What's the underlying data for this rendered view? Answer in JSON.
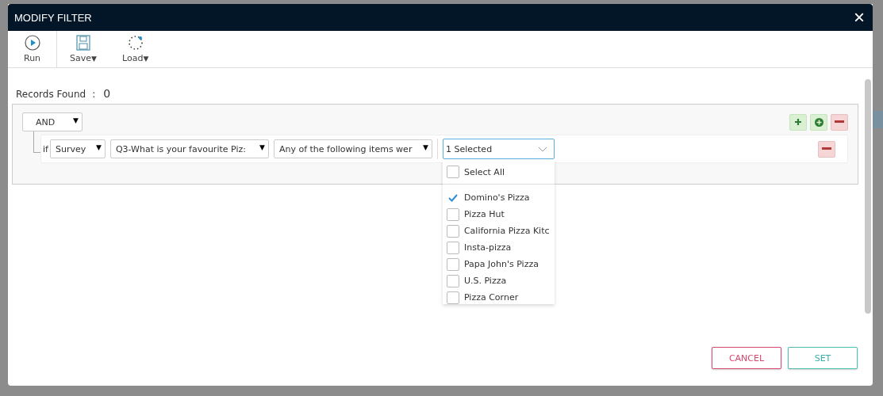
{
  "dialog": {
    "title": "MODIFY FILTER",
    "close": "×"
  },
  "toolbar": [
    {
      "label": "Run",
      "kind": "run"
    },
    {
      "label": "Save",
      "kind": "save",
      "caret": "▼"
    },
    {
      "label": "Load",
      "kind": "load",
      "caret": "▼"
    }
  ],
  "records": {
    "label": "Records Found",
    "separator": ":",
    "value": "0"
  },
  "group": {
    "operator": {
      "value": "AND",
      "caret": "▼"
    },
    "condition": {
      "prefix": "if",
      "source": {
        "value": "Survey",
        "caret": "▼"
      },
      "question": {
        "value": "Q3-What is your favourite Piz:",
        "caret": "▼"
      },
      "operator": {
        "value": "Any of the following items wer",
        "caret": "▼"
      },
      "value": "1 Selected"
    }
  },
  "options": [
    {
      "label": "Select All",
      "checked": false,
      "kind": "all"
    },
    {
      "label": "Domino's Pizza",
      "checked": true,
      "kind": "item"
    },
    {
      "label": "Pizza Hut",
      "checked": false,
      "kind": "item"
    },
    {
      "label": "California Pizza Kitc",
      "checked": false,
      "kind": "item"
    },
    {
      "label": "Insta-pizza",
      "checked": false,
      "kind": "item"
    },
    {
      "label": "Papa John's Pizza",
      "checked": false,
      "kind": "item"
    },
    {
      "label": "U.S. Pizza",
      "checked": false,
      "kind": "item"
    },
    {
      "label": "Pizza Corner",
      "checked": false,
      "kind": "item"
    }
  ],
  "buttons": [
    {
      "label": "CANCEL",
      "kind": "cancel"
    },
    {
      "label": "SET",
      "kind": "set"
    }
  ]
}
